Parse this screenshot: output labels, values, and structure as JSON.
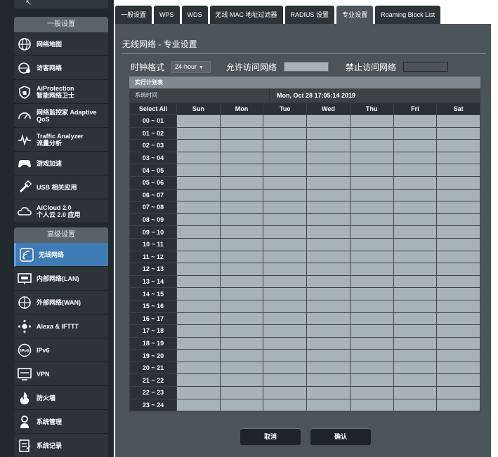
{
  "sidebar": {
    "general_header": "一般设置",
    "advanced_header": "高级设置",
    "general_items": [
      {
        "label": "网络地图",
        "sub": "",
        "icon": "globe-icon"
      },
      {
        "label": "访客网络",
        "sub": "",
        "icon": "guest-network-icon"
      },
      {
        "label": "AiProtection",
        "sub": "智能网络卫士",
        "icon": "shield-lock-icon"
      },
      {
        "label": "网络监控家 Adaptive",
        "sub": "QoS",
        "icon": "speedometer-icon"
      },
      {
        "label": "Traffic Analyzer",
        "sub": "流量分析",
        "icon": "traffic-wave-icon"
      },
      {
        "label": "游戏加速",
        "sub": "",
        "icon": "gamepad-icon"
      },
      {
        "label": "USB 相关应用",
        "sub": "",
        "icon": "usb-icon"
      },
      {
        "label": "AiCloud 2.0",
        "sub": "个人云 2.0 应用",
        "icon": "cloud-icon"
      }
    ],
    "advanced_items": [
      {
        "label": "无线网络",
        "sub": "",
        "icon": "wifi-icon",
        "active": true
      },
      {
        "label": "内部网络(LAN)",
        "sub": "",
        "icon": "lan-monitor-icon"
      },
      {
        "label": "外部网络(WAN)",
        "sub": "",
        "icon": "wan-globe-icon"
      },
      {
        "label": "Alexa & IFTTT",
        "sub": "",
        "icon": "alexa-dots-icon"
      },
      {
        "label": "IPv6",
        "sub": "",
        "icon": "ipv6-globe-icon"
      },
      {
        "label": "VPN",
        "sub": "",
        "icon": "vpn-monitor-icon"
      },
      {
        "label": "防火墙",
        "sub": "",
        "icon": "firewall-flame-icon"
      },
      {
        "label": "系统管理",
        "sub": "",
        "icon": "gear-person-icon"
      },
      {
        "label": "系统记录",
        "sub": "",
        "icon": "log-document-icon"
      }
    ]
  },
  "tabs": [
    {
      "label": "一般设置"
    },
    {
      "label": "WPS"
    },
    {
      "label": "WDS"
    },
    {
      "label": "无线 MAC 地址过滤器"
    },
    {
      "label": "RADIUS 设置"
    },
    {
      "label": "专业设置",
      "active": true
    },
    {
      "label": "Roaming Block List"
    }
  ],
  "panel": {
    "title": "无线网络 - 专业设置",
    "clock_format_label": "时钟格式",
    "clock_format_value": "24-hour",
    "allow_label": "允许访问网络",
    "deny_label": "禁止访问网络"
  },
  "schedule": {
    "title": "实行计划表",
    "system_time_label": "系统时间",
    "system_time_value": "Mon, Oct 28 17:05:14 2019",
    "select_all": "Select All",
    "days": [
      "Sun",
      "Mon",
      "Tue",
      "Wed",
      "Thu",
      "Fri",
      "Sat"
    ],
    "hours": [
      "00 ~ 01",
      "01 ~ 02",
      "02 ~ 03",
      "03 ~ 04",
      "04 ~ 05",
      "05 ~ 06",
      "06 ~ 07",
      "07 ~ 08",
      "08 ~ 09",
      "09 ~ 10",
      "10 ~ 11",
      "11 ~ 12",
      "12 ~ 13",
      "13 ~ 14",
      "14 ~ 15",
      "15 ~ 16",
      "16 ~ 17",
      "17 ~ 18",
      "18 ~ 19",
      "19 ~ 20",
      "20 ~ 21",
      "21 ~ 22",
      "22 ~ 23",
      "23 ~ 24"
    ]
  },
  "buttons": {
    "cancel": "取消",
    "ok": "确认"
  },
  "colors": {
    "allowed_cell": "#a6b3b8",
    "active_nav": "#3f7bb5",
    "panel_bg": "#4b5559"
  }
}
